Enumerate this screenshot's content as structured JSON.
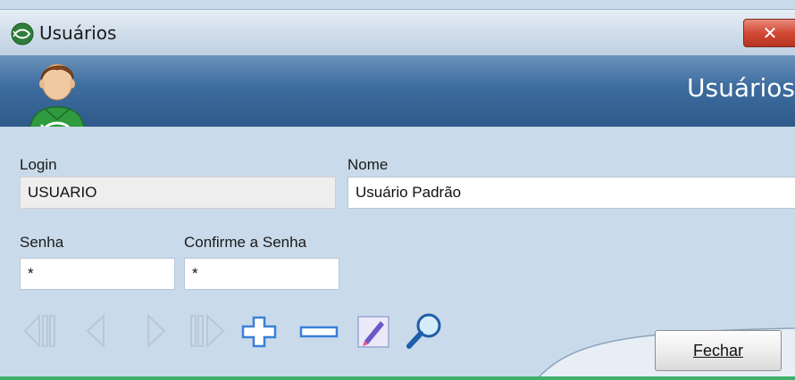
{
  "window": {
    "title": "Usuários",
    "close_label": "✕"
  },
  "header": {
    "title": "Usuários"
  },
  "form": {
    "login_label": "Login",
    "login_value": "USUARIO",
    "nome_label": "Nome",
    "nome_value": "Usuário Padrão",
    "senha_label": "Senha",
    "senha_value": "*",
    "confirme_label": "Confirme a Senha",
    "confirme_value": "*"
  },
  "toolbar": {
    "icons": [
      "first-record-icon",
      "previous-record-icon",
      "next-record-icon",
      "last-record-icon",
      "add-icon",
      "remove-icon",
      "edit-icon",
      "search-icon"
    ]
  },
  "footer": {
    "fechar_label": "Fechar"
  },
  "colors": {
    "header_band": "#3d6c9e",
    "close_button": "#d24a35",
    "icon_blue": "#3b7fd8",
    "icon_disabled": "#b9c8d8"
  }
}
